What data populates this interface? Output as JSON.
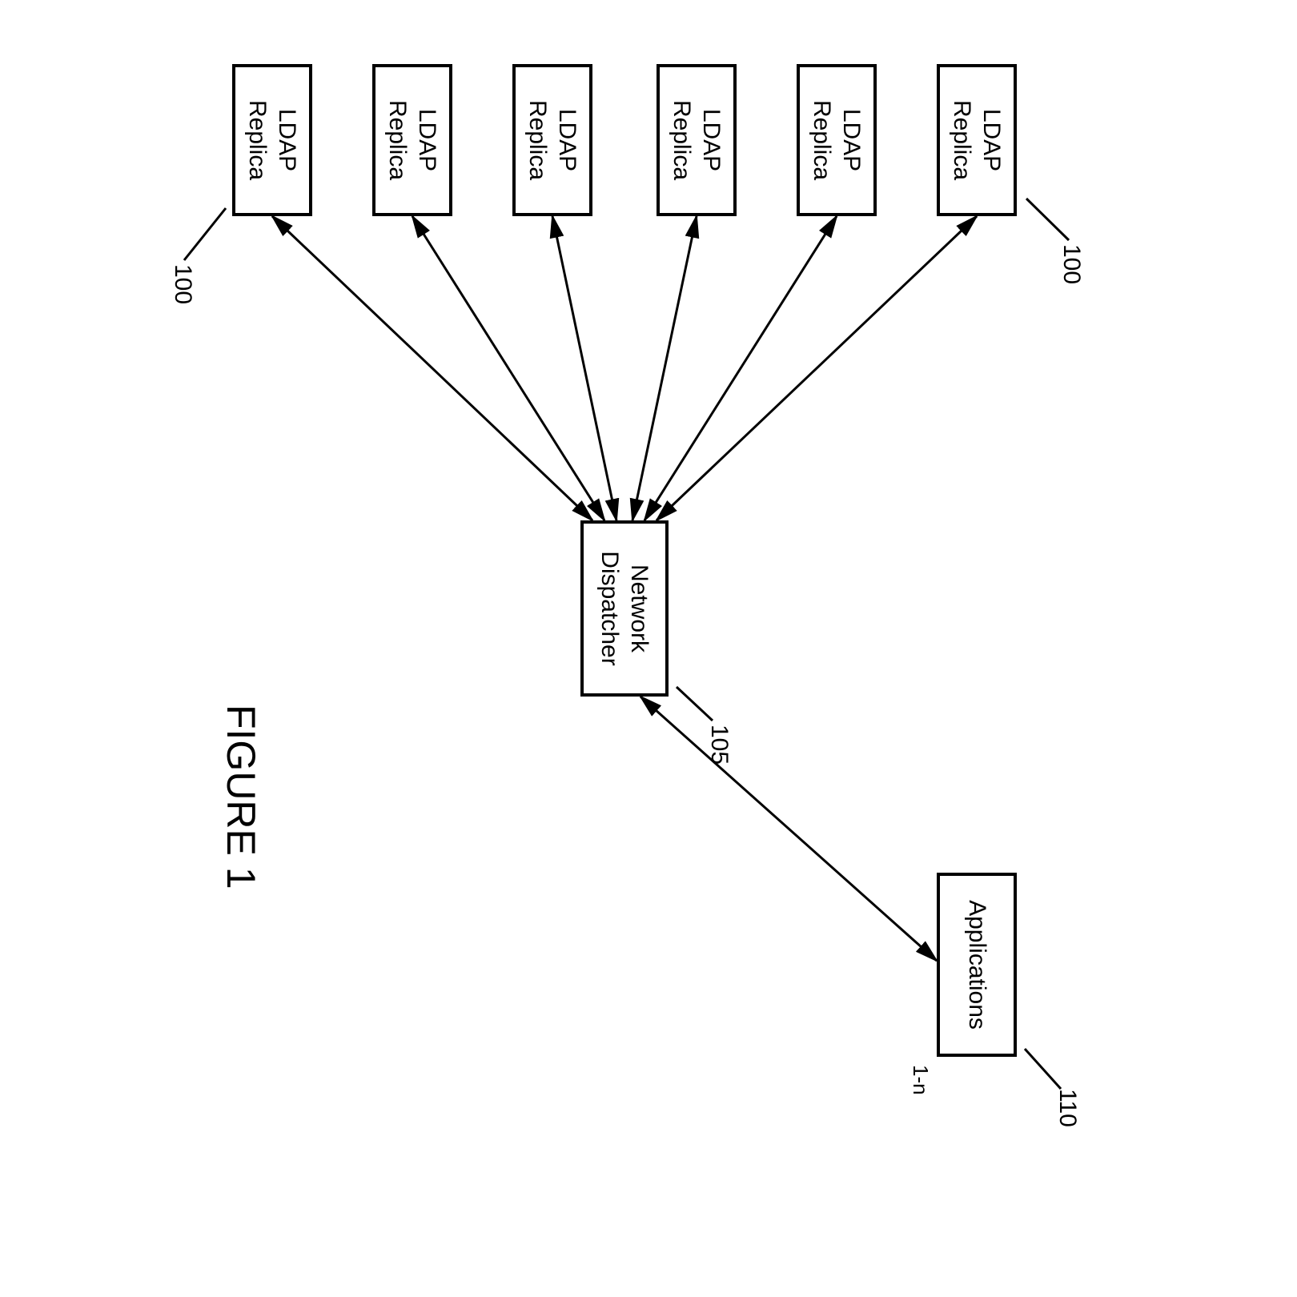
{
  "ldap_replicas": [
    {
      "line1": "LDAP",
      "line2": "Replica"
    },
    {
      "line1": "LDAP",
      "line2": "Replica"
    },
    {
      "line1": "LDAP",
      "line2": "Replica"
    },
    {
      "line1": "LDAP",
      "line2": "Replica"
    },
    {
      "line1": "LDAP",
      "line2": "Replica"
    },
    {
      "line1": "LDAP",
      "line2": "Replica"
    }
  ],
  "dispatcher": {
    "line1": "Network",
    "line2": "Dispatcher"
  },
  "applications": {
    "label": "Applications",
    "count_note": "1-n"
  },
  "callouts": {
    "ldap_top": "100",
    "ldap_bottom": "100",
    "dispatcher": "105",
    "applications": "110"
  },
  "figure_title": "FIGURE 1"
}
